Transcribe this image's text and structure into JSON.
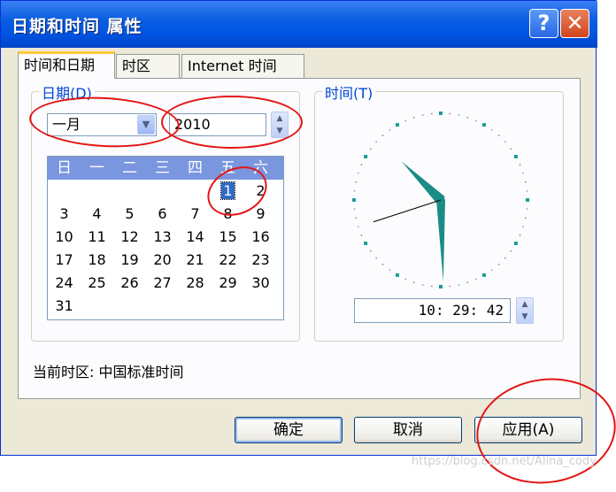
{
  "window": {
    "title": "日期和时间 属性",
    "help_glyph": "?",
    "close_glyph": "✕"
  },
  "tabs": [
    {
      "label": "时间和日期"
    },
    {
      "label": "时区"
    },
    {
      "label": "Internet 时间"
    }
  ],
  "date_group": {
    "title": "日期(D)",
    "month": "一月",
    "year": "2010",
    "weekday_headers": [
      "日",
      "一",
      "二",
      "三",
      "四",
      "五",
      "六"
    ],
    "weeks": [
      [
        "",
        "",
        "",
        "",
        "",
        "1",
        "2"
      ],
      [
        "3",
        "4",
        "5",
        "6",
        "7",
        "8",
        "9"
      ],
      [
        "10",
        "11",
        "12",
        "13",
        "14",
        "15",
        "16"
      ],
      [
        "17",
        "18",
        "19",
        "20",
        "21",
        "22",
        "23"
      ],
      [
        "24",
        "25",
        "26",
        "27",
        "28",
        "29",
        "30"
      ],
      [
        "31",
        "",
        "",
        "",
        "",
        "",
        ""
      ]
    ],
    "selected_day": "1"
  },
  "time_group": {
    "title": "时间(T)",
    "time_value": "10: 29: 42",
    "clock": {
      "hour": 10,
      "minute": 29,
      "second": 42
    }
  },
  "timezone_label": "当前时区: 中国标准时间",
  "buttons": {
    "ok": "确定",
    "cancel": "取消",
    "apply": "应用(A)"
  },
  "watermark": "https://blog.csdn.net/Alina_cody",
  "colors": {
    "title_bar": "#0054e3",
    "calendar_header": "#7a96df",
    "group_title": "#0046d5",
    "clock_hand": "#1a8c86",
    "annotation_red": "#e31414"
  }
}
